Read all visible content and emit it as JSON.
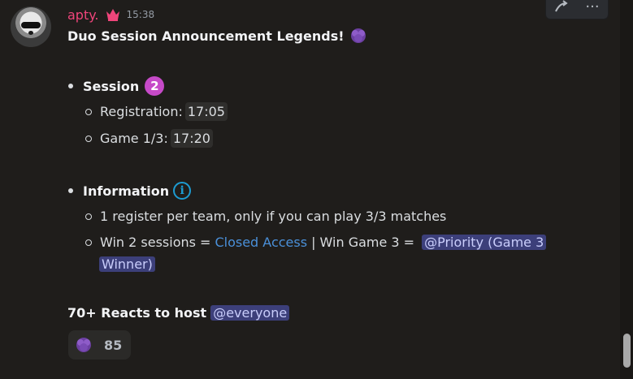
{
  "message": {
    "username": "apty.",
    "timestamp": "15:38",
    "title": "Duo Session Announcement Legends!",
    "session": {
      "label": "Session",
      "badge": "2",
      "items": [
        {
          "label": "Registration:",
          "value": "17:05"
        },
        {
          "label": "Game 1/3:",
          "value": "17:20"
        }
      ]
    },
    "information": {
      "label": "Information",
      "icon_text": "i",
      "line1": "1 register per team, only if you can play 3/3 matches",
      "line2_prefix": "Win 2 sessions =",
      "line2_link": "Closed Access",
      "line2_middle": "| Win Game 3 =",
      "mention_part1": "@Priority (Game 3",
      "mention_part2": "Winner)"
    },
    "footer_text": "70+ Reacts to host",
    "footer_mention": "@everyone",
    "reaction_count": "85"
  },
  "actions": {
    "more": "···"
  },
  "icons": {
    "crown": "crown-icon",
    "emoji": "pompom-emoji-icon",
    "info": "info-icon",
    "reply": "reply-icon",
    "more": "more-icon"
  },
  "colors": {
    "background": "#1f1d1b",
    "username": "#f0457b",
    "badge": "#c64ac8",
    "info": "#1d9bd1",
    "link": "#4a90d9",
    "mention_bg": "#3c3f7a"
  }
}
